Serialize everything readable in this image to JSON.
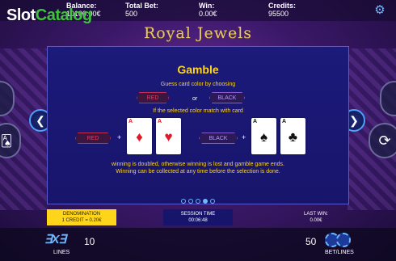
{
  "header": {
    "balance_label": "Balance:",
    "balance_value": "10100.00€",
    "total_bet_label": "Total Bet:",
    "total_bet_value": "500",
    "win_label": "Win:",
    "win_value": "0.00€",
    "credits_label": "Credits:",
    "credits_value": "95500",
    "settings_icon": "gear-icon"
  },
  "watermark": {
    "part1": "Slot",
    "part2": "Catalog"
  },
  "game_title": "Royal Jewels",
  "gamble": {
    "title": "Gamble",
    "line1": "Guess card color by choosing",
    "red_label": "RED",
    "or_label": "or",
    "black_label": "BLACK",
    "line2": "If the selected color match with card",
    "example_red": "RED",
    "example_black": "BLACK",
    "plus": "+",
    "cards": [
      {
        "rank": "A",
        "suit": "♦",
        "color": "red"
      },
      {
        "rank": "A",
        "suit": "♥",
        "color": "red"
      },
      {
        "rank": "A",
        "suit": "♠",
        "color": "black"
      },
      {
        "rank": "A",
        "suit": "♣",
        "color": "black"
      }
    ],
    "footer1": "winning is doubled, otherwise winning is lost and gamble game ends.",
    "footer2": "Winning can be collected at any time before the selection is done.",
    "page_dots": 5,
    "active_dot": 4
  },
  "nav": {
    "prev_icon": "chevron-left-icon",
    "next_icon": "chevron-right-icon"
  },
  "bottom": {
    "denomination_label": "DENOMINATION",
    "denomination_value": "1 CREDIT = 0.20€",
    "session_label": "SESSION TIME",
    "session_value": "00:06:48",
    "last_win_label": "LAST WIN:",
    "last_win_value": "0.00€",
    "lines_value": "10",
    "lines_label": "LINES",
    "bet_value": "50",
    "bet_label": "BET/LINES"
  },
  "colors": {
    "accent_yellow": "#ffd51c",
    "panel_blue": "#1c1a7a",
    "arrow_blue": "#4aa0ff"
  }
}
